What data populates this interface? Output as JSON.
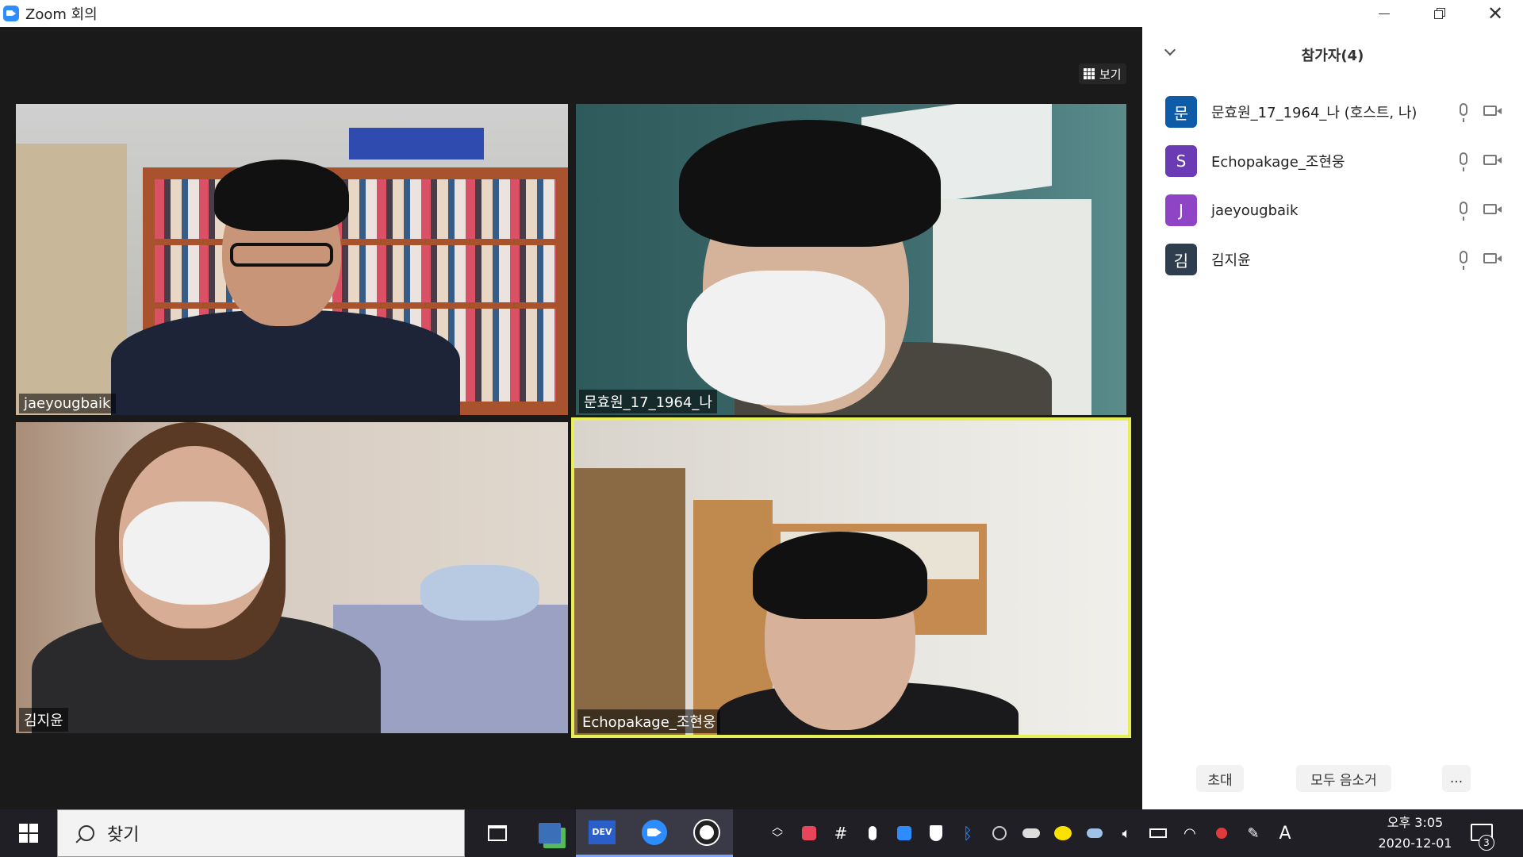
{
  "window": {
    "title": "Zoom 회의",
    "controls": [
      "minimize",
      "restore",
      "close"
    ]
  },
  "meeting": {
    "view_label": "보기",
    "tiles": [
      {
        "name": "jaeyougbaik",
        "active": false
      },
      {
        "name": "문효원_17_1964_나",
        "active": false
      },
      {
        "name": "김지윤",
        "active": false
      },
      {
        "name": "Echopakage_조현웅",
        "active": true
      }
    ]
  },
  "participants": {
    "header": "참가자(4)",
    "list": [
      {
        "initial": "문",
        "name": "문효원_17_1964_나 (호스트, 나)",
        "color": "#0e5ca8"
      },
      {
        "initial": "S",
        "name": "Echopakage_조현웅",
        "color": "#6a3bb5"
      },
      {
        "initial": "J",
        "name": "jaeyougbaik",
        "color": "#8e44c4"
      },
      {
        "initial": "김",
        "name": "김지윤",
        "color": "#2f3e4f"
      }
    ],
    "invite_label": "초대",
    "mute_all_label": "모두 음소거",
    "more_label": "..."
  },
  "taskbar": {
    "search_placeholder": "찾기",
    "clock_time": "오후 3:05",
    "clock_date": "2020-12-01",
    "ime_label": "A",
    "notification_count": "3"
  }
}
